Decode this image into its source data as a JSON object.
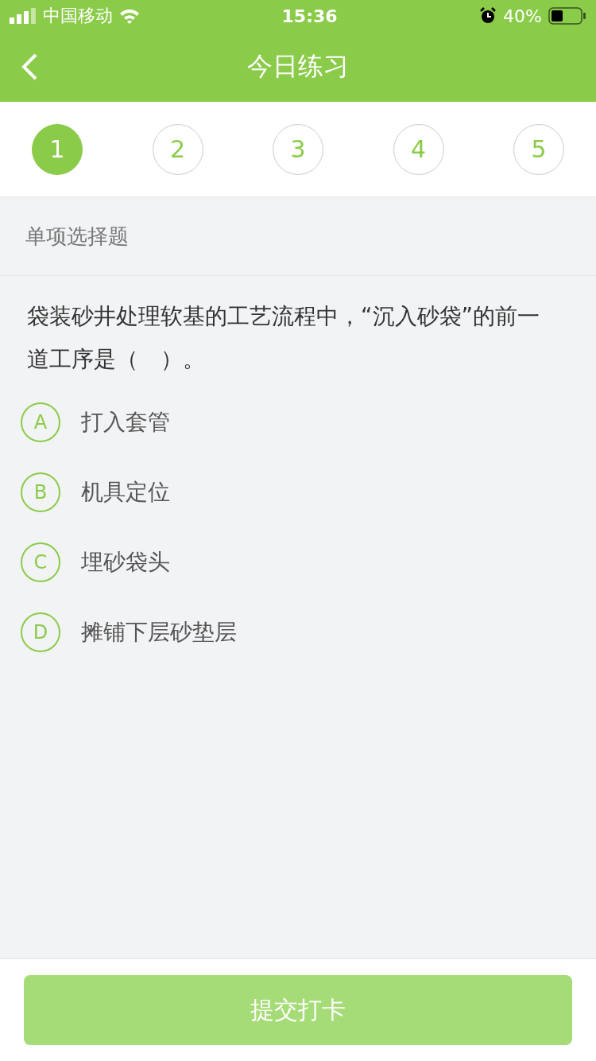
{
  "status_bar": {
    "carrier": "中国移动",
    "time": "15:36",
    "battery": "40%"
  },
  "nav": {
    "title": "今日练习"
  },
  "steps": [
    {
      "label": "1",
      "selected": true
    },
    {
      "label": "2",
      "selected": false
    },
    {
      "label": "3",
      "selected": false
    },
    {
      "label": "4",
      "selected": false
    },
    {
      "label": "5",
      "selected": false
    }
  ],
  "question_type": "单项选择题",
  "question": "袋装砂井处理软基的工艺流程中，“沉入砂袋”的前一道工序是（　）。",
  "options": [
    {
      "letter": "A",
      "text": "打入套管",
      "selected": false
    },
    {
      "letter": "B",
      "text": "机具定位",
      "selected": false
    },
    {
      "letter": "C",
      "text": "埋砂袋头",
      "selected": false
    },
    {
      "letter": "D",
      "text": "摊铺下层砂垫层",
      "selected": false
    }
  ],
  "submit": {
    "label": "提交打卡",
    "disabled": true
  }
}
